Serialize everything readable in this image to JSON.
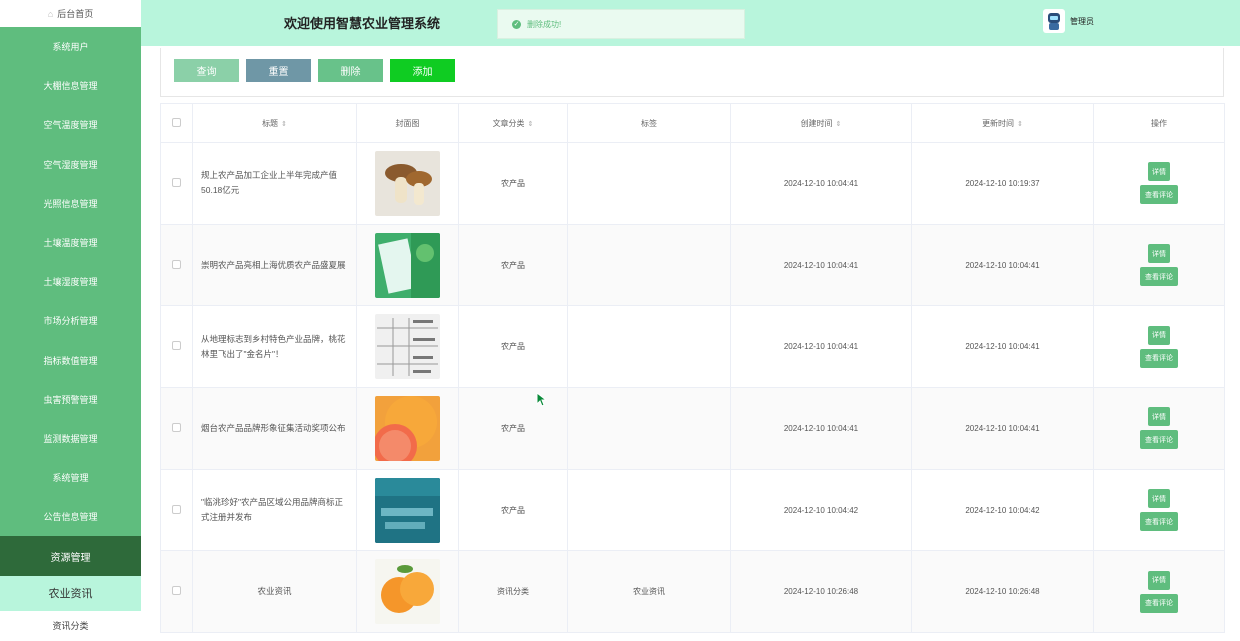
{
  "sidebar": {
    "home": "后台首页",
    "items": [
      "系统用户",
      "大棚信息管理",
      "空气温度管理",
      "空气湿度管理",
      "光照信息管理",
      "土壤温度管理",
      "土壤湿度管理",
      "市场分析管理",
      "指标数值管理",
      "虫害预警管理",
      "监测数据管理",
      "系统管理",
      "公告信息管理"
    ],
    "active": "资源管理",
    "sub_active": "农业资讯",
    "sub_item": "资讯分类"
  },
  "header": {
    "title": "欢迎使用智慧农业管理系统",
    "toast": "删除成功!",
    "user": "管理员"
  },
  "toolbar": {
    "query": "查询",
    "reset": "重置",
    "delete": "删除",
    "add": "添加"
  },
  "table": {
    "headers": [
      "标题",
      "封面图",
      "文章分类",
      "标签",
      "创建时间",
      "更新时间",
      "操作"
    ],
    "rows": [
      {
        "title": "规上农产品加工企业上半年完成产值50.18亿元",
        "category": "农产品",
        "tag": "",
        "created": "2024-12-10 10:04:41",
        "updated": "2024-12-10 10:19:37"
      },
      {
        "title": "崇明农产品亮相上海优质农产品盛夏展",
        "category": "农产品",
        "tag": "",
        "created": "2024-12-10 10:04:41",
        "updated": "2024-12-10 10:04:41"
      },
      {
        "title": "从地理标志到乡村特色产业品牌，桃花林里飞出了\"金名片\"！",
        "category": "农产品",
        "tag": "",
        "created": "2024-12-10 10:04:41",
        "updated": "2024-12-10 10:04:41"
      },
      {
        "title": "烟台农产品品牌形象征集活动奖项公布",
        "category": "农产品",
        "tag": "",
        "created": "2024-12-10 10:04:41",
        "updated": "2024-12-10 10:04:41"
      },
      {
        "title": "\"临洮珍好\"农产品区域公用品牌商标正式注册并发布",
        "category": "农产品",
        "tag": "",
        "created": "2024-12-10 10:04:42",
        "updated": "2024-12-10 10:04:42"
      },
      {
        "title": "农业资讯",
        "category": "资讯分类",
        "tag": "农业资讯",
        "created": "2024-12-10 10:26:48",
        "updated": "2024-12-10 10:26:48"
      }
    ],
    "detail_label": "详情",
    "comment_label": "查看评论"
  },
  "colors": {
    "sidebar": "#5fbd7e",
    "topbar": "#b8f5dc",
    "active": "#2e6a3a",
    "add": "#0fcc22"
  }
}
